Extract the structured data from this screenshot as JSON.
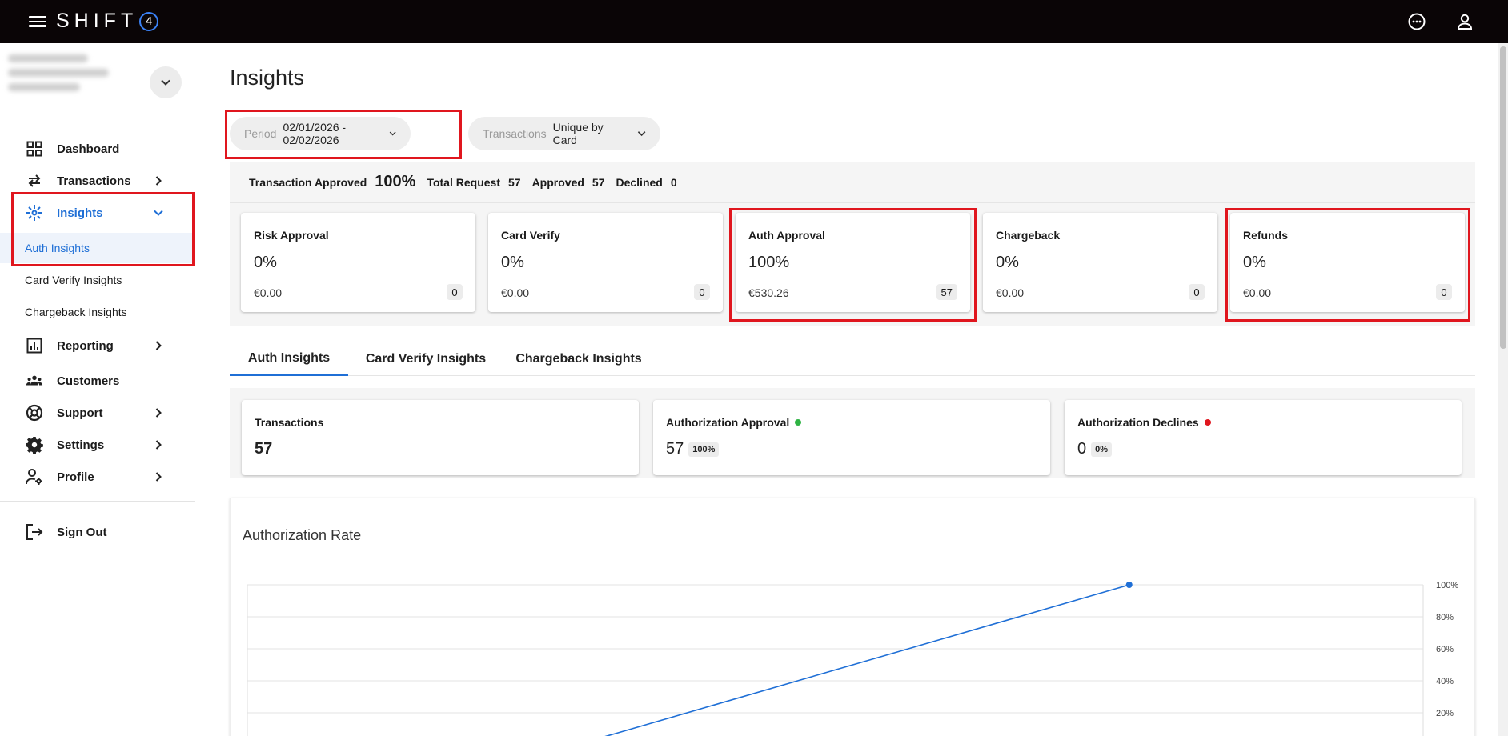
{
  "topbar": {
    "logo_text": "SHIFT",
    "logo_badge": "4",
    "icons": [
      "menu-icon",
      "chat-icon",
      "user-icon"
    ]
  },
  "sidebar": {
    "nav": [
      {
        "label": "Dashboard",
        "icon": "dashboard-icon"
      },
      {
        "label": "Transactions",
        "icon": "transfer-icon"
      },
      {
        "label": "Insights",
        "icon": "insights-icon"
      },
      {
        "label": "Reporting",
        "icon": "reporting-icon"
      },
      {
        "label": "Customers",
        "icon": "customers-icon"
      },
      {
        "label": "Support",
        "icon": "support-icon"
      },
      {
        "label": "Settings",
        "icon": "settings-icon"
      },
      {
        "label": "Profile",
        "icon": "profile-icon"
      }
    ],
    "sub_items": [
      "Auth Insights",
      "Card Verify Insights",
      "Chargeback Insights"
    ],
    "sign_out": "Sign Out"
  },
  "main": {
    "title": "Insights",
    "filters": {
      "period_key": "Period",
      "period_value": "02/01/2026 - 02/02/2026",
      "transactions_key": "Transactions",
      "transactions_value": "Unique by Card"
    },
    "summary": {
      "approved_label": "Transaction Approved",
      "approved_value": "100%",
      "total_label": "Total Request",
      "total_value": "57",
      "approved2_label": "Approved",
      "approved2_value": "57",
      "declined_label": "Declined",
      "declined_value": "0"
    },
    "metrics": [
      {
        "title": "Risk Approval",
        "percent": "0%",
        "amount": "€0.00",
        "count": "0"
      },
      {
        "title": "Card Verify",
        "percent": "0%",
        "amount": "€0.00",
        "count": "0"
      },
      {
        "title": "Auth Approval",
        "percent": "100%",
        "amount": "€530.26",
        "count": "57"
      },
      {
        "title": "Chargeback",
        "percent": "0%",
        "amount": "€0.00",
        "count": "0"
      },
      {
        "title": "Refunds",
        "percent": "0%",
        "amount": "€0.00",
        "count": "0"
      }
    ],
    "tabs": [
      "Auth Insights",
      "Card Verify Insights",
      "Chargeback Insights"
    ],
    "stats": [
      {
        "title": "Transactions",
        "value": "57",
        "badge": ""
      },
      {
        "title": "Authorization Approval",
        "value": "57",
        "badge": "100%",
        "dot_color": "#2fb344"
      },
      {
        "title": "Authorization Declines",
        "value": "0",
        "badge": "0%",
        "dot_color": "#e0161e"
      }
    ]
  },
  "colors": {
    "accent": "#1f6fd6",
    "highlight": "#e0161e",
    "topbar": "#0a0506"
  },
  "chart_data": {
    "type": "line",
    "title": "Authorization Rate",
    "y_ticks": [
      "100%",
      "80%",
      "60%",
      "40%",
      "20%"
    ],
    "ylim": [
      0,
      100
    ],
    "series": [
      {
        "values": [
          0,
          100
        ],
        "x_fraction": [
          0.28,
          0.75
        ],
        "color": "#1f6fd6"
      }
    ],
    "grid": true,
    "y_axis_side": "right"
  }
}
